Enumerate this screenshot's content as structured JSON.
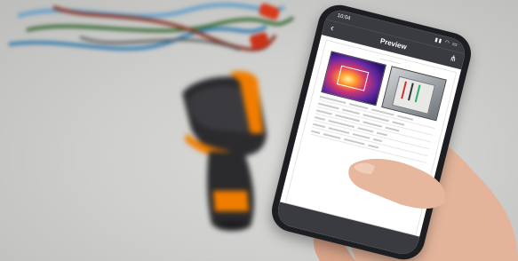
{
  "phone": {
    "status_time": "10:04",
    "nav_title": "Preview",
    "back_icon": "chevron-left-icon",
    "share_icon": "share-icon"
  },
  "colors": {
    "background": "#cfcfcd",
    "gun_orange": "#f07d00",
    "gun_body": "#2b2b2e",
    "phone_body": "#1d1e22",
    "nav_bar": "#3a3b40"
  }
}
